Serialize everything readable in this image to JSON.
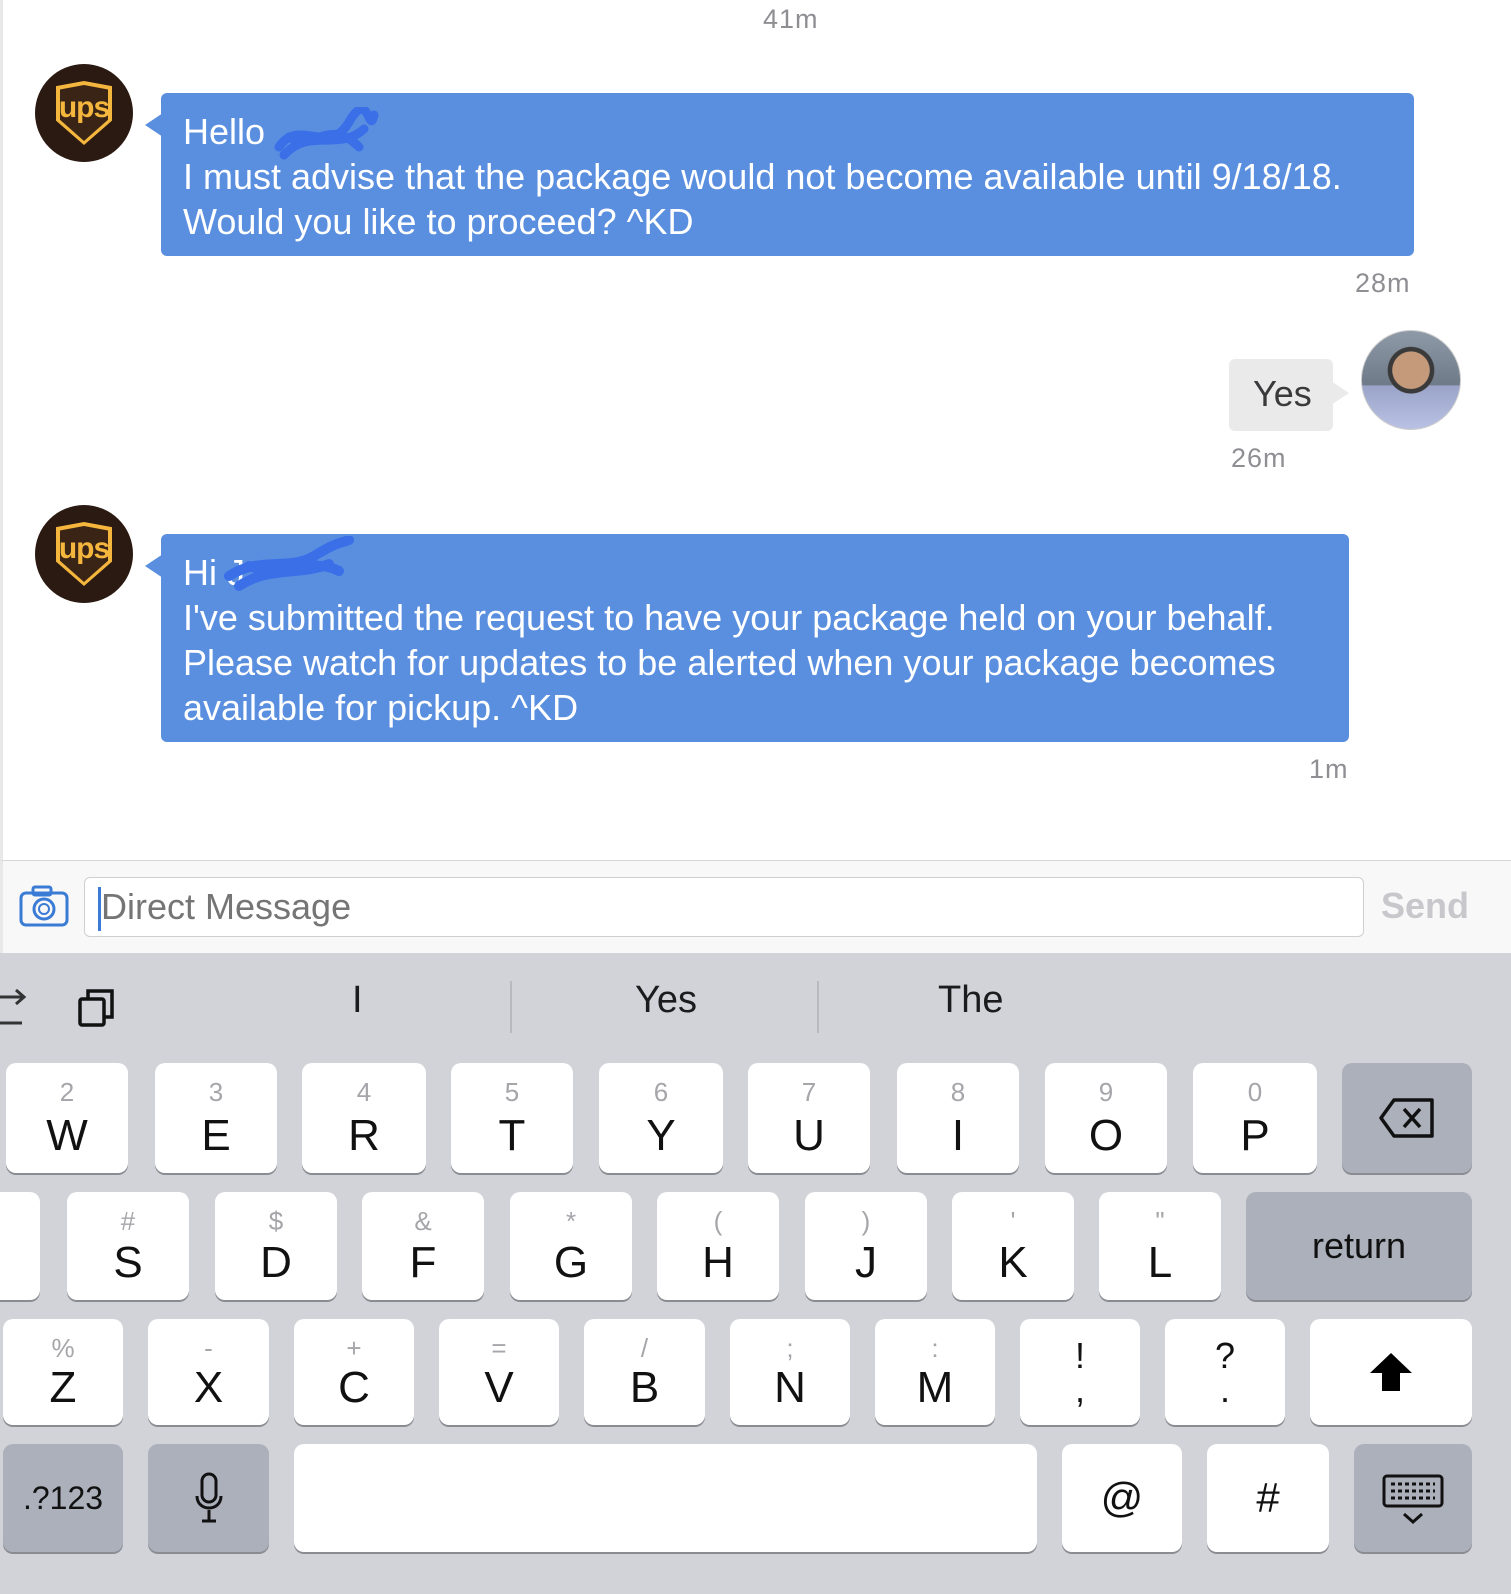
{
  "chat": {
    "timestamp_top": "41m",
    "messages": [
      {
        "sender": "ups",
        "lines": [
          "Hello",
          "I must advise that the package would not become available until 9/18/18.",
          "Would you like to proceed? ^KD"
        ],
        "time": "28m"
      },
      {
        "sender": "me",
        "text": "Yes",
        "time": "26m"
      },
      {
        "sender": "ups",
        "lines": [
          "Hi J",
          "I've submitted the request to have your package held on your behalf.",
          "Please watch for updates to be alerted when your package becomes",
          "available for pickup. ^KD"
        ],
        "time": "1m"
      }
    ],
    "ups_logo_text": "ups"
  },
  "composer": {
    "placeholder": "Direct Message",
    "send_label": "Send"
  },
  "keyboard": {
    "suggestions": [
      "I",
      "Yes",
      "The"
    ],
    "row1": [
      {
        "sub": "2",
        "main": "W"
      },
      {
        "sub": "3",
        "main": "E"
      },
      {
        "sub": "4",
        "main": "R"
      },
      {
        "sub": "5",
        "main": "T"
      },
      {
        "sub": "6",
        "main": "Y"
      },
      {
        "sub": "7",
        "main": "U"
      },
      {
        "sub": "8",
        "main": "I"
      },
      {
        "sub": "9",
        "main": "O"
      },
      {
        "sub": "0",
        "main": "P"
      }
    ],
    "row2": [
      {
        "sub": "#",
        "main": "S"
      },
      {
        "sub": "$",
        "main": "D"
      },
      {
        "sub": "&",
        "main": "F"
      },
      {
        "sub": "*",
        "main": "G"
      },
      {
        "sub": "(",
        "main": "H"
      },
      {
        "sub": ")",
        "main": "J"
      },
      {
        "sub": "'",
        "main": "K"
      },
      {
        "sub": "\"",
        "main": "L"
      }
    ],
    "row3": [
      {
        "sub": "%",
        "main": "Z"
      },
      {
        "sub": "-",
        "main": "X"
      },
      {
        "sub": "+",
        "main": "C"
      },
      {
        "sub": "=",
        "main": "V"
      },
      {
        "sub": "/",
        "main": "B"
      },
      {
        "sub": ";",
        "main": "N"
      },
      {
        "sub": ":",
        "main": "M"
      }
    ],
    "punct1": {
      "top": "!",
      "bottom": ","
    },
    "punct2": {
      "top": "?",
      "bottom": "."
    },
    "return_label": "return",
    "numbers_label": ".?123",
    "at_label": "@",
    "hash_label": "#",
    "icons": [
      "backspace-icon",
      "shift-icon",
      "microphone-icon",
      "keyboard-dismiss-icon",
      "clipboard-icon",
      "cursor-move-icon",
      "camera-icon"
    ]
  }
}
